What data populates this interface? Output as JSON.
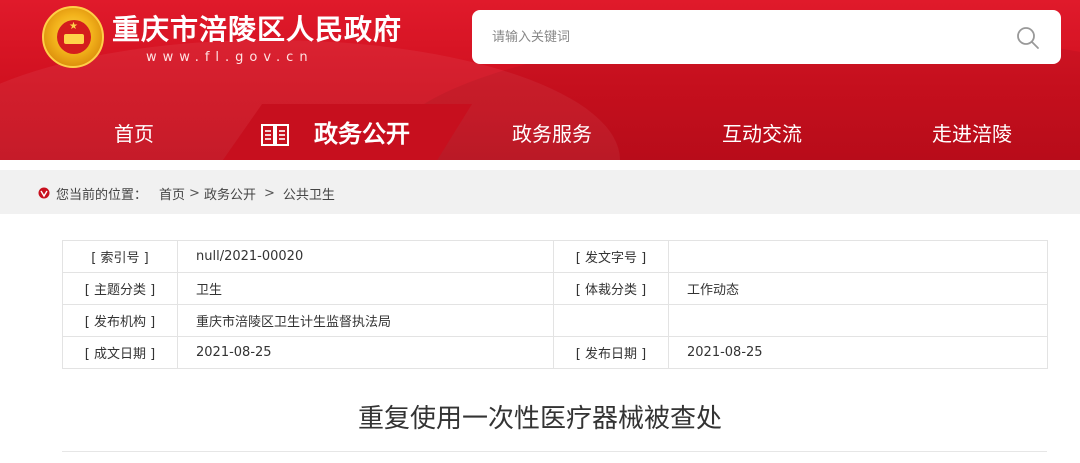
{
  "header": {
    "site_title": "重庆市涪陵区人民政府",
    "site_url": "www.fl.gov.cn",
    "search_placeholder": "请输入关键词",
    "colors": {
      "primary_red": "#d0101f",
      "active_tab_red": "#c70f1e"
    }
  },
  "nav": {
    "items": [
      {
        "label": "首页"
      },
      {
        "label": "政务公开",
        "active": true
      },
      {
        "label": "政务服务"
      },
      {
        "label": "互动交流"
      },
      {
        "label": "走进涪陵"
      }
    ]
  },
  "breadcrumb": {
    "prefix": "您当前的位置：",
    "items": [
      "首页",
      "政务公开",
      "公共卫生"
    ],
    "separators": [
      ">",
      ">"
    ]
  },
  "meta": {
    "rows": [
      {
        "k1": "[ 索引号 ]",
        "v1": "null/2021-00020",
        "k2": "[ 发文字号 ]",
        "v2": ""
      },
      {
        "k1": "[ 主题分类 ]",
        "v1": "卫生",
        "k2": "[ 体裁分类 ]",
        "v2": "工作动态"
      },
      {
        "k1": "[ 发布机构 ]",
        "v1": "重庆市涪陵区卫生计生监督执法局",
        "k2": "",
        "v2": ""
      },
      {
        "k1": "[ 成文日期 ]",
        "v1": "2021-08-25",
        "k2": "[ 发布日期 ]",
        "v2": "2021-08-25"
      }
    ]
  },
  "article": {
    "title": "重复使用一次性医疗器械被查处"
  }
}
